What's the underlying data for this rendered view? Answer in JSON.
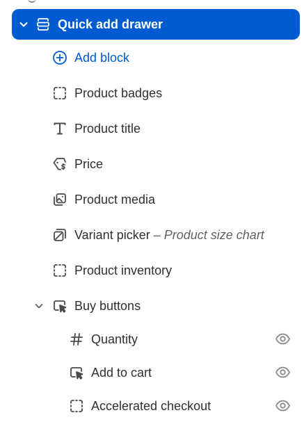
{
  "colors": {
    "accent": "#005bd3",
    "text": "#303030",
    "muted": "#616161",
    "icon": "#4a4a4a"
  },
  "selected_section": {
    "label": "Quick add drawer",
    "icon": "section-icon",
    "expanded": true
  },
  "add_block": {
    "label": "Add block",
    "icon": "plus-circle-icon"
  },
  "blocks": [
    {
      "label": "Product badges",
      "icon": "dashed-square-icon"
    },
    {
      "label": "Product title",
      "icon": "text-icon"
    },
    {
      "label": "Price",
      "icon": "price-tag-icon"
    },
    {
      "label": "Product media",
      "icon": "media-icon"
    },
    {
      "label": "Variant picker",
      "suffix": "– Product size chart",
      "icon": "variant-icon"
    },
    {
      "label": "Product inventory",
      "icon": "dashed-square-icon"
    },
    {
      "label": "Buy buttons",
      "icon": "cursor-icon",
      "expanded": true
    }
  ],
  "sub_blocks": [
    {
      "label": "Quantity",
      "icon": "hash-icon",
      "visibility_icon": "eye-icon"
    },
    {
      "label": "Add to cart",
      "icon": "cursor-icon",
      "visibility_icon": "eye-icon"
    },
    {
      "label": "Accelerated checkout",
      "icon": "dashed-square-icon",
      "visibility_icon": "eye-icon"
    }
  ]
}
